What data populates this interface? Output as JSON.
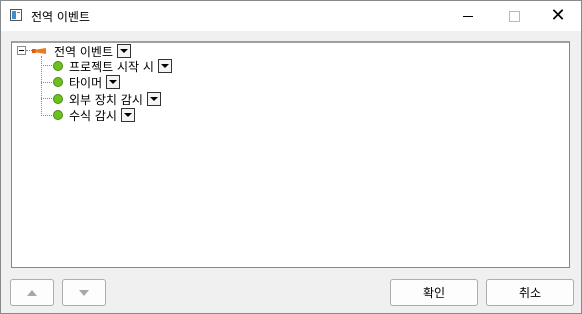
{
  "window": {
    "title": "전역 이벤트"
  },
  "tree": {
    "root": {
      "label": "전역 이벤트",
      "icon": "event-flag-icon"
    },
    "children": [
      {
        "label": "프로젝트 시작 시",
        "icon": "green-dot-icon"
      },
      {
        "label": "타이머",
        "icon": "green-dot-icon"
      },
      {
        "label": "외부 장치 감시",
        "icon": "green-dot-icon"
      },
      {
        "label": "수식 감시",
        "icon": "green-dot-icon"
      }
    ]
  },
  "buttons": {
    "up": "▲",
    "down": "▼",
    "ok": "확인",
    "cancel": "취소"
  },
  "colors": {
    "status_green": "#6cc21d",
    "event_orange": "#f07a1a"
  }
}
